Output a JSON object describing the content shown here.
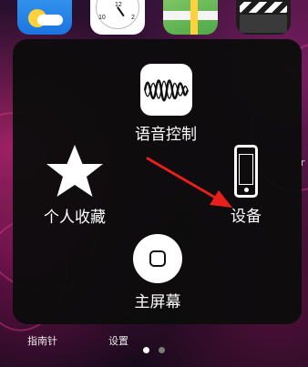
{
  "home_screen": {
    "dock_labels": {
      "compass": "指南针",
      "settings": "设置"
    },
    "page_dots": [
      {
        "active": true
      },
      {
        "active": false
      }
    ],
    "side_fragment": "r"
  },
  "assistive_touch": {
    "voice_control": {
      "label": "语音控制",
      "icon": "waveform-icon"
    },
    "favorites": {
      "label": "个人收藏",
      "icon": "star-icon"
    },
    "device": {
      "label": "设备",
      "icon": "iphone-icon"
    },
    "home": {
      "label": "主屏幕",
      "icon": "home-button-icon"
    }
  },
  "colors": {
    "panel": "#0c0c0c",
    "annotation_arrow": "#e8201c",
    "wallpaper_accent": "#c42878"
  }
}
